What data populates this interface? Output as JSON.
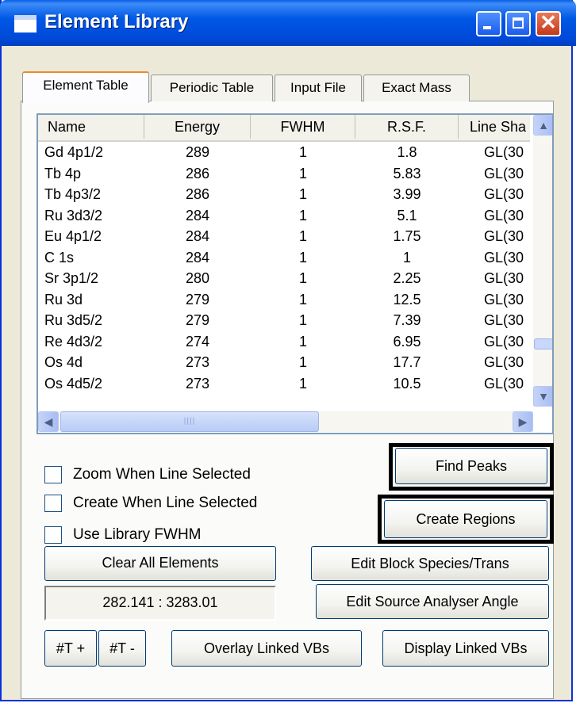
{
  "window": {
    "title": "Element Library"
  },
  "tabs": [
    "Element Table",
    "Periodic Table",
    "Input File",
    "Exact Mass"
  ],
  "table": {
    "columns": [
      "Name",
      "Energy",
      "FWHM",
      "R.S.F.",
      "Line Sha"
    ],
    "rows": [
      [
        "Gd 4p1/2",
        "289",
        "1",
        "1.8",
        "GL(30"
      ],
      [
        "Tb 4p",
        "286",
        "1",
        "5.83",
        "GL(30"
      ],
      [
        "Tb 4p3/2",
        "286",
        "1",
        "3.99",
        "GL(30"
      ],
      [
        "Ru 3d3/2",
        "284",
        "1",
        "5.1",
        "GL(30"
      ],
      [
        "Eu 4p1/2",
        "284",
        "1",
        "1.75",
        "GL(30"
      ],
      [
        "C 1s",
        "284",
        "1",
        "1",
        "GL(30"
      ],
      [
        "Sr 3p1/2",
        "280",
        "1",
        "2.25",
        "GL(30"
      ],
      [
        "Ru 3d",
        "279",
        "1",
        "12.5",
        "GL(30"
      ],
      [
        "Ru 3d5/2",
        "279",
        "1",
        "7.39",
        "GL(30"
      ],
      [
        "Re 4d3/2",
        "274",
        "1",
        "6.95",
        "GL(30"
      ],
      [
        "Os 4d",
        "273",
        "1",
        "17.7",
        "GL(30"
      ],
      [
        "Os 4d5/2",
        "273",
        "1",
        "10.5",
        "GL(30"
      ]
    ]
  },
  "checkboxes": {
    "zoom": "Zoom When Line Selected",
    "create": "Create When Line Selected",
    "fwhm": "Use Library FWHM"
  },
  "buttons": {
    "find_peaks": "Find Peaks",
    "create_regions": "Create Regions",
    "clear_all": "Clear All Elements",
    "edit_block": "Edit Block Species/Trans",
    "edit_source": "Edit Source Analyser Angle",
    "t_plus": "#T +",
    "t_minus": "#T -",
    "overlay": "Overlay Linked VBs",
    "display": "Display Linked VBs"
  },
  "readout": "282.141 : 3283.01"
}
